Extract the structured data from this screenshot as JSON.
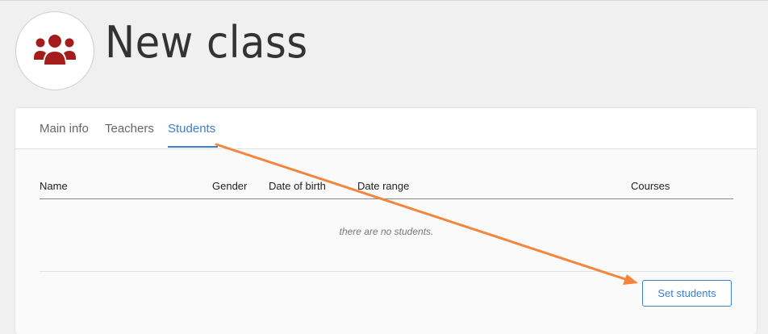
{
  "header": {
    "title": "New class",
    "icon": "users-group-icon",
    "icon_color": "#a51c1c"
  },
  "tabs": [
    {
      "label": "Main info",
      "active": false
    },
    {
      "label": "Teachers",
      "active": false
    },
    {
      "label": "Students",
      "active": true
    }
  ],
  "table": {
    "columns": [
      "Name",
      "Gender",
      "Date of birth",
      "Date range",
      "Courses"
    ],
    "rows": [],
    "empty_message": "there are no students."
  },
  "actions": {
    "set_students_label": "Set students"
  },
  "colors": {
    "accent": "#3d7fd1",
    "annotation_arrow": "#f5843c"
  }
}
